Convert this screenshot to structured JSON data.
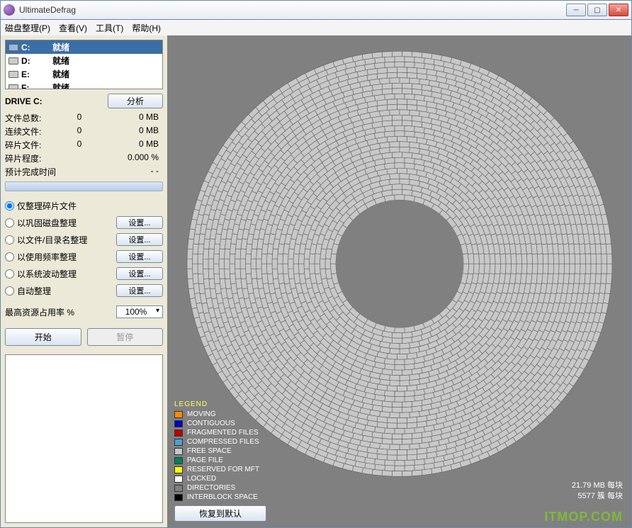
{
  "window": {
    "title": "UltimateDefrag"
  },
  "menu": {
    "disk": "磁盘整理(P)",
    "view": "查看(V)",
    "tools": "工具(T)",
    "help": "帮助(H)"
  },
  "drives": [
    {
      "name": "C:",
      "status": "就绪",
      "selected": true
    },
    {
      "name": "D:",
      "status": "就绪",
      "selected": false
    },
    {
      "name": "E:",
      "status": "就绪",
      "selected": false
    },
    {
      "name": "F:",
      "status": "就绪",
      "selected": false
    }
  ],
  "drive_header": {
    "label": "DRIVE C:",
    "analyze": "分析"
  },
  "stats": {
    "total_files": {
      "label": "文件总数:",
      "count": "0",
      "size": "0 MB"
    },
    "contiguous": {
      "label": "连续文件:",
      "count": "0",
      "size": "0 MB"
    },
    "fragmented": {
      "label": "碎片文件:",
      "count": "0",
      "size": "0 MB"
    },
    "frag_degree": {
      "label": "碎片程度:",
      "count": "",
      "size": "0.000 %"
    },
    "eta": {
      "label": "预计完成时间",
      "count": "",
      "size": "- -"
    }
  },
  "options": {
    "frag_only": {
      "label": "仅整理碎片文件"
    },
    "consolidate": {
      "label": "以巩固磁盘整理",
      "btn": "设置..."
    },
    "by_name": {
      "label": "以文件/目录名整理",
      "btn": "设置..."
    },
    "by_usage": {
      "label": "以使用频率整理",
      "btn": "设置..."
    },
    "by_system": {
      "label": "以系统波动整理",
      "btn": "设置..."
    },
    "auto": {
      "label": "自动整理",
      "btn": "设置..."
    }
  },
  "resource": {
    "label": "最高资源占用率 %",
    "value": "100%"
  },
  "actions": {
    "start": "开始",
    "pause": "暂停"
  },
  "legend": {
    "title": "LEGEND",
    "items": [
      {
        "label": "MOVING",
        "color": "#ff8c00"
      },
      {
        "label": "CONTIGUOUS",
        "color": "#0000c0"
      },
      {
        "label": "FRAGMENTED FILES",
        "color": "#c00000"
      },
      {
        "label": "COMPRESSED FILES",
        "color": "#4aa0d8"
      },
      {
        "label": "FREE SPACE",
        "color": "#c8c8c8"
      },
      {
        "label": "PAGE FILE",
        "color": "#008060"
      },
      {
        "label": "RESERVED FOR MFT",
        "color": "#ffff00"
      },
      {
        "label": "LOCKED",
        "color": "#ffffff"
      },
      {
        "label": "DIRECTORIES",
        "color": "#808080"
      },
      {
        "label": "INTERBLOCK SPACE",
        "color": "#000000"
      }
    ]
  },
  "footer": {
    "block_size": "21.79 MB 每块",
    "cluster": "5577 簇 每块",
    "restore": "恢复到默认"
  },
  "watermark": "ITMOP.COM"
}
